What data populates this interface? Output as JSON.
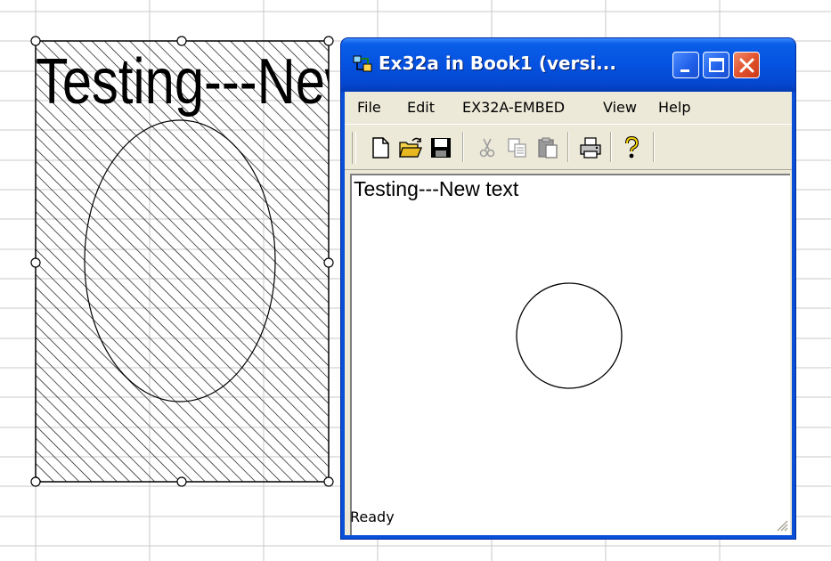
{
  "ole_object": {
    "text": "Testing---New"
  },
  "window": {
    "title": "Ex32a in Book1 (versi...",
    "menu": [
      "File",
      "Edit",
      "EX32A-EMBED",
      "View",
      "Help"
    ],
    "toolbar": [
      "new-icon",
      "open-icon",
      "save-icon",
      "cut-icon",
      "copy-icon",
      "paste-icon",
      "print-icon",
      "help-icon"
    ],
    "view_text": "Testing---New text",
    "status": "Ready"
  },
  "colors": {
    "titlebar": "#0552e0",
    "close_button": "#e0502a",
    "chrome": "#ece9d8",
    "grid": "#c9c9c9"
  }
}
